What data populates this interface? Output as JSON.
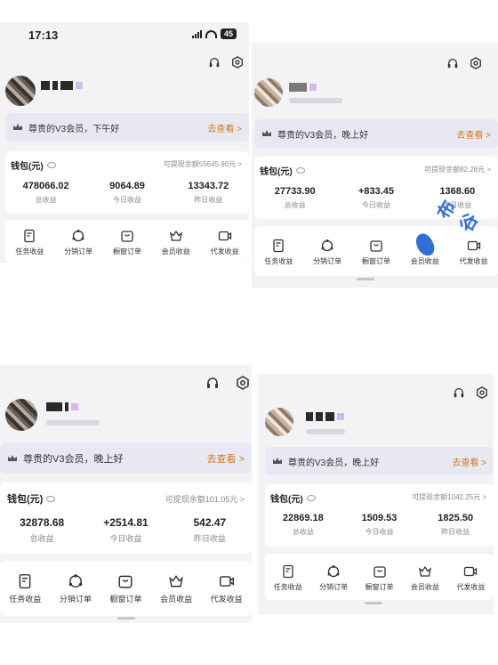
{
  "status_bar": {
    "time": "17:13",
    "battery": "45"
  },
  "vip_suffix_afternoon": "",
  "panels": [
    {
      "vip_text": "尊贵的V3会员，下午好",
      "vip_link": "去查看 >",
      "wallet_label": "钱包(元)",
      "withdrawable": "可提现余额55645.90元 >",
      "total": "478066.02",
      "today": "9064.89",
      "yesterday": "13343.72"
    },
    {
      "vip_text": "尊贵的V3会员，晚上好",
      "vip_link": "去查看 >",
      "wallet_label": "钱包(元)",
      "withdrawable": "可提现余额82.28元 >",
      "total": "27733.90",
      "today": "+833.45",
      "yesterday": "1368.60"
    },
    {
      "vip_text": "尊贵的V3会员，晚上好",
      "vip_link": "去查看 >",
      "wallet_label": "钱包(元)",
      "withdrawable": "可提现余额101.05元 >",
      "total": "32878.68",
      "today": "+2514.81",
      "yesterday": "542.47"
    },
    {
      "vip_text": "尊贵的V3会员，晚上好",
      "vip_link": "去查看 >",
      "wallet_label": "钱包(元)",
      "withdrawable": "可提现余额1042.25元 >",
      "total": "22869.18",
      "today": "1509.53",
      "yesterday": "1825.50"
    }
  ],
  "stat_labels": {
    "total": "总收益",
    "today": "今日收益",
    "yesterday": "昨日收益"
  },
  "menu": [
    {
      "label": "任务收益",
      "icon": "task-income-icon"
    },
    {
      "label": "分销订单",
      "icon": "distribution-order-icon"
    },
    {
      "label": "橱窗订单",
      "icon": "showcase-order-icon"
    },
    {
      "label": "会员收益",
      "icon": "member-income-icon"
    },
    {
      "label": "代发收益",
      "icon": "dropship-income-icon"
    }
  ],
  "watermark": "布谷",
  "colors": {
    "accent_orange": "#d07a1c",
    "vip_bg": "#e8e8f3",
    "panel_bg": "#f3f3f5",
    "watermark_blue": "#2f6fd6"
  }
}
